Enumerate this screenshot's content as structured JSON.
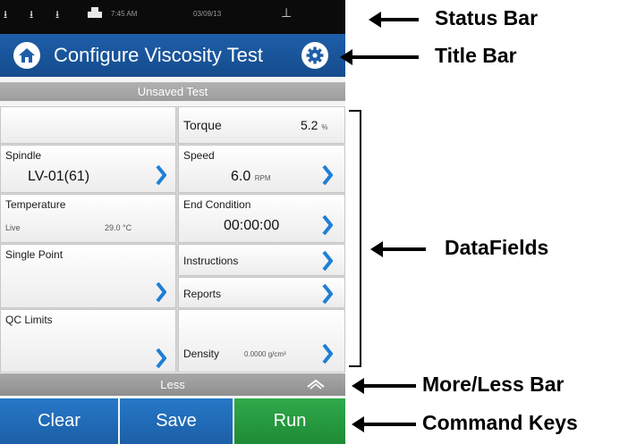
{
  "status_bar": {
    "time": "7:45 AM",
    "date": "03/09/13",
    "usb_icons": [
      "usb-icon-1",
      "usb-icon-2",
      "usb-icon-3"
    ],
    "printer_icon": "printer-icon",
    "level_icon": "level-icon"
  },
  "title_bar": {
    "title": "Configure Viscosity Test",
    "home_icon": "home-icon",
    "settings_icon": "gear-icon"
  },
  "unsaved_bar": {
    "label": "Unsaved Test"
  },
  "fields": {
    "torque": {
      "label": "Torque",
      "value": "5.2",
      "unit": "%"
    },
    "spindle": {
      "label": "Spindle",
      "value": "LV-01(61)"
    },
    "speed": {
      "label": "Speed",
      "value": "6.0",
      "unit": "RPM"
    },
    "temperature": {
      "label": "Temperature",
      "mode": "Live",
      "value": "29.0",
      "unit": "°C"
    },
    "end_condition": {
      "label": "End Condition",
      "value": "00:00:00"
    },
    "single_point": {
      "label": "Single Point"
    },
    "instructions": {
      "label": "Instructions"
    },
    "reports": {
      "label": "Reports"
    },
    "qc_limits": {
      "label": "QC Limits"
    },
    "density": {
      "label": "Density",
      "value": "0.0000",
      "unit": "g/cm³"
    }
  },
  "less_bar": {
    "label": "Less"
  },
  "commands": {
    "clear": "Clear",
    "save": "Save",
    "run": "Run"
  },
  "annotations": {
    "status_bar": "Status Bar",
    "title_bar": "Title Bar",
    "data_fields": "DataFields",
    "more_less_bar": "More/Less Bar",
    "command_keys": "Command Keys"
  },
  "colors": {
    "title_blue": "#1e5ea9",
    "chevron_blue": "#1f7fd6",
    "run_green": "#2faa4a"
  }
}
